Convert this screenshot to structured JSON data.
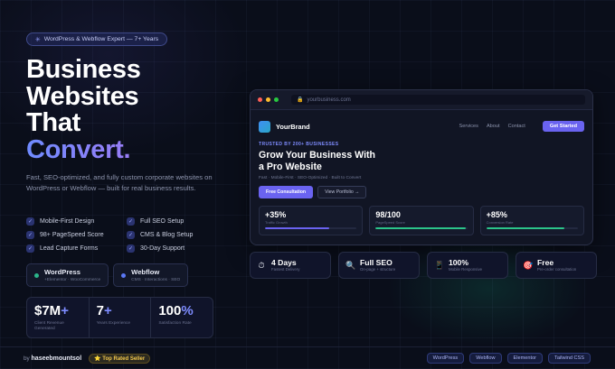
{
  "hero": {
    "badge_icon": "sparkle-icon",
    "badge": "WordPress & Webflow Expert — 7+ Years",
    "title_line1": "Business",
    "title_line2": "Websites",
    "title_line3": "That",
    "title_accent": "Convert.",
    "description": "Fast, SEO-optimized, and fully custom corporate websites on WordPress or Webflow — built for real business results."
  },
  "features": [
    {
      "icon": "check-icon",
      "label": "Mobile-First Design"
    },
    {
      "icon": "check-icon",
      "label": "Full SEO Setup"
    },
    {
      "icon": "check-icon",
      "label": "98+ PageSpeed Score"
    },
    {
      "icon": "check-icon",
      "label": "CMS & Blog Setup"
    },
    {
      "icon": "check-icon",
      "label": "Lead Capture Forms"
    },
    {
      "icon": "check-icon",
      "label": "30-Day Support"
    }
  ],
  "platforms": [
    {
      "name": "WordPress",
      "sub": "+Elementor · WooCommerce",
      "color": "#2bb58a"
    },
    {
      "name": "Webflow",
      "sub": "CMS · Interactions · SEO",
      "color": "#5b78f5"
    }
  ],
  "stats": [
    {
      "value": "$7M",
      "suffix": "+",
      "label": "Client Revenue Generated"
    },
    {
      "value": "7",
      "suffix": "+",
      "label": "Years Experience"
    },
    {
      "value": "100",
      "suffix": "%",
      "label": "Satisfaction Rate"
    }
  ],
  "browser": {
    "url": "yourbusiness.com",
    "brand": "YourBrand",
    "nav": [
      "Services",
      "About",
      "Contact"
    ],
    "cta": "Get Started",
    "trust": "TRUSTED BY 200+ BUSINESSES",
    "headline": "Grow Your Business With a Pro Website",
    "sub": "Fast · Mobile-First · SEO-Optimized · Built to Convert",
    "btn_primary": "Free Consultation",
    "btn_secondary": "View Portfolio →",
    "metrics": [
      {
        "value": "+35%",
        "label": "Traffic Growth",
        "progress": 0.7,
        "color": "#6a63f0"
      },
      {
        "value": "98/100",
        "label": "PageSpeed Score",
        "progress": 0.98,
        "color": "#2bc48a"
      },
      {
        "value": "+85%",
        "label": "Conversion Rate",
        "progress": 0.85,
        "color": "#2bc48a"
      }
    ]
  },
  "pills": [
    {
      "icon": "clock-icon",
      "glyph": "⏱",
      "value": "4 Days",
      "label": "Fastest Delivery"
    },
    {
      "icon": "search-icon",
      "glyph": "🔍",
      "value": "Full SEO",
      "label": "On-page + structure"
    },
    {
      "icon": "mobile-icon",
      "glyph": "📱",
      "value": "100%",
      "label": "Mobile Responsive"
    },
    {
      "icon": "target-icon",
      "glyph": "🎯",
      "value": "Free",
      "label": "Pre-order consultation"
    }
  ],
  "footer": {
    "by": "by",
    "author": "haseebmountsol",
    "seller": "⭐ Top Rated Seller",
    "tags": [
      "WordPress",
      "Webflow",
      "Elementor",
      "Tailwind CSS"
    ]
  }
}
